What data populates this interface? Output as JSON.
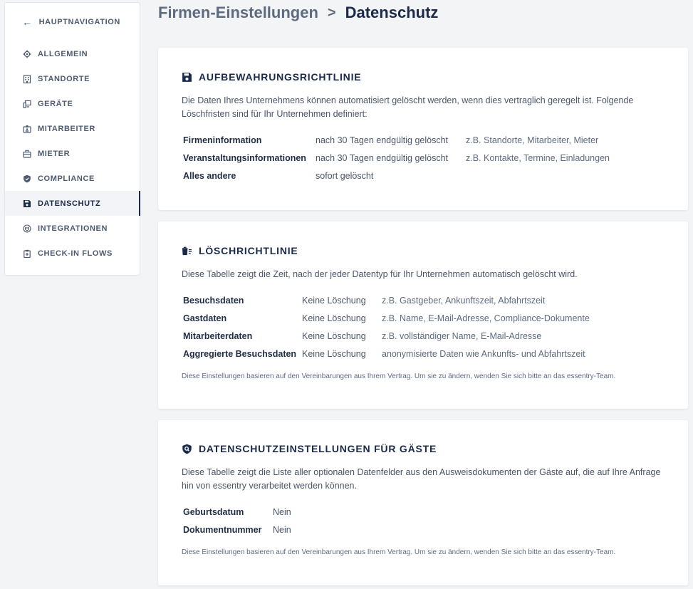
{
  "sidebar": {
    "back_label": "HAUPTNAVIGATION",
    "items": [
      {
        "label": "ALLGEMEIN",
        "icon": "gear-icon"
      },
      {
        "label": "STANDORTE",
        "icon": "building-icon"
      },
      {
        "label": "GERÄTE",
        "icon": "devices-icon"
      },
      {
        "label": "MITARBEITER",
        "icon": "badge-icon"
      },
      {
        "label": "MIETER",
        "icon": "briefcase-icon"
      },
      {
        "label": "COMPLIANCE",
        "icon": "shield-icon"
      },
      {
        "label": "DATENSCHUTZ",
        "icon": "save-icon"
      },
      {
        "label": "INTEGRATIONEN",
        "icon": "plug-icon"
      },
      {
        "label": "CHECK-IN FLOWS",
        "icon": "clipboard-icon"
      }
    ],
    "active_index": 6
  },
  "breadcrumb": {
    "parent": "Firmen-Einstellungen",
    "separator": ">",
    "current": "Datenschutz"
  },
  "retention": {
    "title": "AUFBEWAHRUNGSRICHTLINIE",
    "description": "Die Daten Ihres Unternehmens können automatisiert gelöscht werden, wenn dies vertraglich geregelt ist. Folgende Löschfristen sind für Ihr Unternehmen definiert:",
    "rows": [
      {
        "name": "Firmeninformation",
        "value": "nach 30 Tagen endgültig gelöscht",
        "example": "z.B. Standorte, Mitarbeiter, Mieter"
      },
      {
        "name": "Veranstaltungsinformationen",
        "value": "nach 30 Tagen endgültig gelöscht",
        "example": "z.B. Kontakte, Termine, Einladungen"
      },
      {
        "name": "Alles andere",
        "value": "sofort gelöscht",
        "example": ""
      }
    ]
  },
  "deletion": {
    "title": "LÖSCHRICHTLINIE",
    "description": "Diese Tabelle zeigt die Zeit, nach der jeder Datentyp für Ihr Unternehmen automatisch gelöscht wird.",
    "rows": [
      {
        "name": "Besuchsdaten",
        "value": "Keine Löschung",
        "example": "z.B. Gastgeber, Ankunftszeit, Abfahrtszeit"
      },
      {
        "name": "Gastdaten",
        "value": "Keine Löschung",
        "example": "z.B. Name, E-Mail-Adresse, Compliance-Dokumente"
      },
      {
        "name": "Mitarbeiterdaten",
        "value": "Keine Löschung",
        "example": "z.B. vollständiger Name, E-Mail-Adresse"
      },
      {
        "name": "Aggregierte Besuchsdaten",
        "value": "Keine Löschung",
        "example": "anonymisierte Daten wie Ankunfts- und Abfahrtszeit"
      }
    ],
    "note": "Diese Einstellungen basieren auf den Vereinbarungen aus Ihrem Vertrag. Um sie zu ändern, wenden Sie sich bitte an das essentry-Team."
  },
  "guest_privacy": {
    "title": "DATENSCHUTZEINSTELLUNGEN FÜR GÄSTE",
    "description": "Diese Tabelle zeigt die Liste aller optionalen Datenfelder aus den Ausweisdokumenten der Gäste auf, die auf Ihre Anfrage hin von essentry verarbeitet werden können.",
    "rows": [
      {
        "name": "Geburtsdatum",
        "value": "Nein"
      },
      {
        "name": "Dokumentnummer",
        "value": "Nein"
      }
    ],
    "note": "Diese Einstellungen basieren auf den Vereinbarungen aus Ihrem Vertrag. Um sie zu ändern, wenden Sie sich bitte an das essentry-Team."
  }
}
